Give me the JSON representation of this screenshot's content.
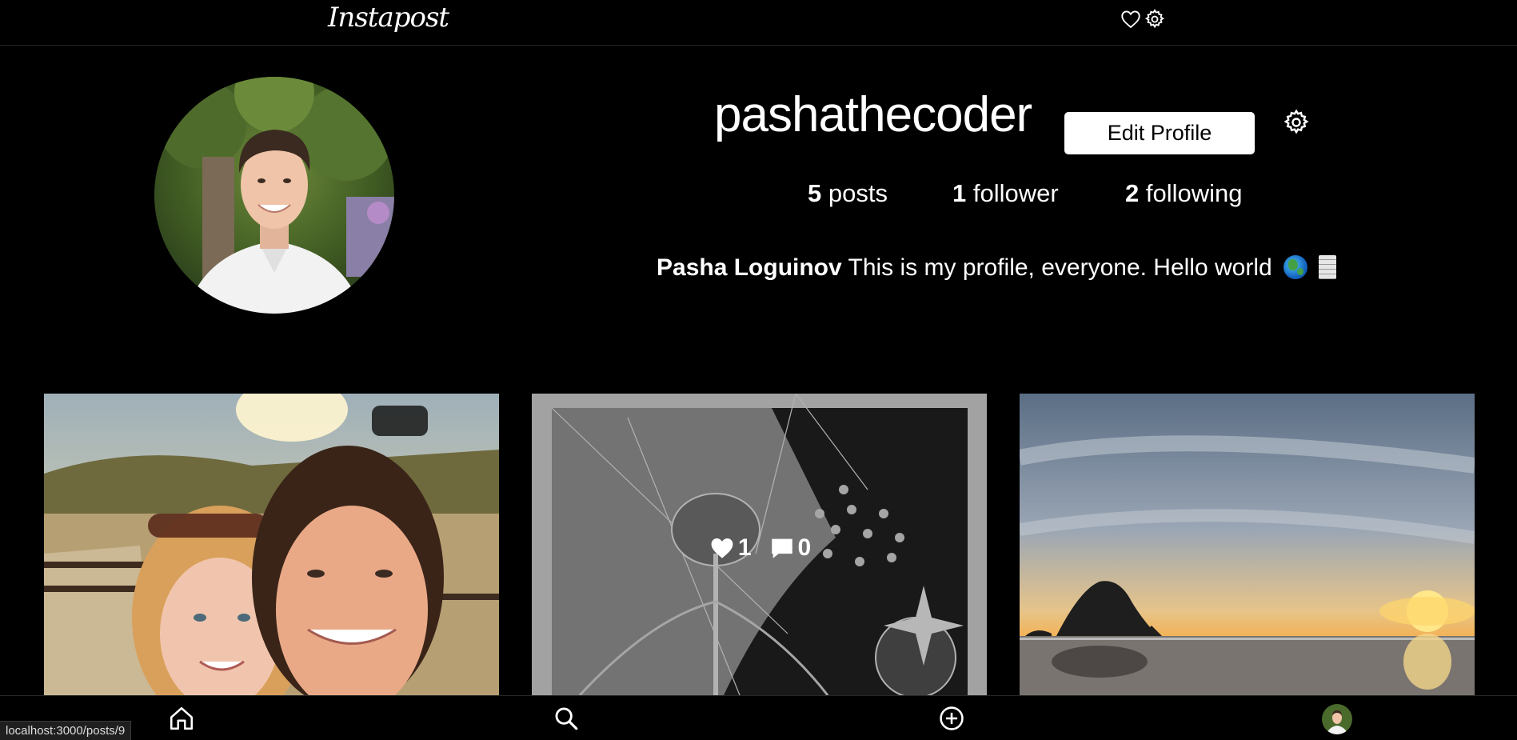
{
  "app": {
    "logo_text": "Instapost"
  },
  "header": {
    "icons": [
      "heart-icon",
      "gear-icon"
    ]
  },
  "profile": {
    "username": "pashathecoder",
    "edit_button_label": "Edit Profile",
    "stats": {
      "posts_count": "5",
      "posts_label": "posts",
      "followers_count": "1",
      "followers_label": "follower",
      "following_count": "2",
      "following_label": "following"
    },
    "full_name": "Pasha Loguinov",
    "bio_text": "This is my profile, everyone. Hello world",
    "bio_emojis": [
      "globe-emoji",
      "scroll-emoji"
    ]
  },
  "posts": [
    {
      "alt": "selfie-couple",
      "hover": false
    },
    {
      "alt": "ink-illustration",
      "hover": true,
      "likes": "1",
      "comments": "0"
    },
    {
      "alt": "haystack-rock-sunset",
      "hover": false
    }
  ],
  "bottom_nav": {
    "items": [
      "home-icon",
      "search-icon",
      "add-post-icon",
      "profile-avatar"
    ]
  },
  "status_bar": {
    "url": "localhost:3000/posts/9"
  },
  "colors": {
    "background": "#000000",
    "text": "#ffffff",
    "button_bg": "#ffffff",
    "divider": "#262626"
  }
}
